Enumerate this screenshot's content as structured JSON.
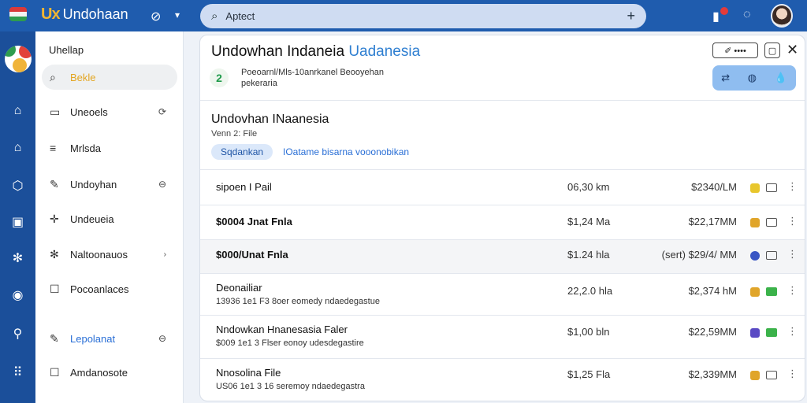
{
  "colors": {
    "topbar": "#1f5cae",
    "rail": "#1b4f9a",
    "accent_yellow": "#e3a520",
    "accent_blue": "#2a6fd6"
  },
  "topbar": {
    "brand_mark": "Ux",
    "brand_name": "Undohaan",
    "search_value": "Aptect"
  },
  "sidebar": {
    "title": "Uhellap",
    "items": [
      {
        "label": "Bekle",
        "icon": "search-icon"
      },
      {
        "label": "Uneoels",
        "icon": "briefcase-icon"
      },
      {
        "label": "Mrlsda",
        "icon": "list-icon"
      },
      {
        "label": "Undoyhan",
        "icon": "pen-icon"
      },
      {
        "label": "Undeueia",
        "icon": "sparkle-icon"
      },
      {
        "label": "Naltoonauos",
        "icon": "gear-icon"
      },
      {
        "label": "Pocoanlaces",
        "icon": "checkbox-icon"
      },
      {
        "label": "Lepolanat",
        "icon": "edit-icon"
      },
      {
        "label": "Amdanosote",
        "icon": "calendar-icon"
      }
    ]
  },
  "panel": {
    "title_main": "Undowhan Indaneia",
    "title_accent": "Uadanesia",
    "subtitle": "Poeoarnl/Mls-10anrkanel Beooyehan pekeraria",
    "btn_edit": "✐ ••••",
    "section_title": "Undovhan INaanesia",
    "section_meta": "Venn 2: File",
    "chip": "Sqdankan",
    "chip_link": "IOatame bisarna vooonobikan",
    "rows": [
      {
        "name": "sipoen I Pail",
        "desc": "",
        "size": "06,30 km",
        "price": "$2340/LM",
        "c1": "#e8c62c"
      },
      {
        "name": "$0004 Jnat Fnla",
        "desc": "",
        "size": "$1,24 Ma",
        "price": "$22,17MM",
        "c1": "#e0a52a"
      },
      {
        "name": "$000/Unat Fnla",
        "desc": "",
        "size": "$1.24 hla",
        "price": "(sert) $29/4/ MM",
        "c1": "#3a56c4"
      },
      {
        "name": "Deonailiar",
        "desc": "13936 1e1 F3 8oer eomedy ndaedegastue",
        "size": "22,2.0 hla",
        "price": "$2,374 hM",
        "c1": "#e0a52a"
      },
      {
        "name": "Nndowkan Hnanesasia Faler",
        "desc": "$009 1e1 3 Flser eonoy udesdegastire",
        "size": "$1,00 bln",
        "price": "$22,59MM",
        "c1": "#5a4ac4"
      },
      {
        "name": "Nnosolina File",
        "desc": "US06 1e1 3 16 seremoy ndaedegastra",
        "size": "$1,25 Fla",
        "price": "$2,339MM",
        "c1": "#e0a52a"
      }
    ]
  }
}
